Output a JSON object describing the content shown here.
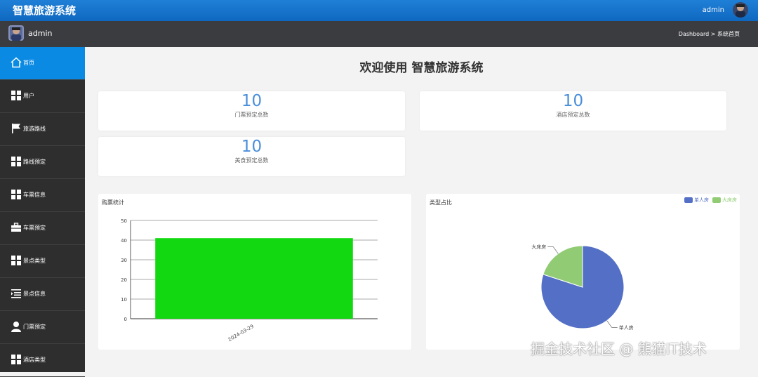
{
  "header": {
    "app_title": "智慧旅游系统",
    "user": "admin"
  },
  "userbar": {
    "user": "admin",
    "breadcrumb": "Dashboard > 系统首页"
  },
  "sidebar": {
    "items": [
      {
        "label": "首页",
        "icon": "home-icon",
        "active": true
      },
      {
        "label": "用户",
        "icon": "grid-icon"
      },
      {
        "label": "旅游路线",
        "icon": "flag-icon"
      },
      {
        "label": "路线预定",
        "icon": "grid-icon"
      },
      {
        "label": "车票信息",
        "icon": "grid-icon"
      },
      {
        "label": "车票预定",
        "icon": "briefcase-icon"
      },
      {
        "label": "景点类型",
        "icon": "grid-icon"
      },
      {
        "label": "景点信息",
        "icon": "list-indent-icon"
      },
      {
        "label": "门票预定",
        "icon": "user-icon"
      },
      {
        "label": "酒店类型",
        "icon": "grid-icon"
      }
    ]
  },
  "main": {
    "welcome": "欢迎使用 智慧旅游系统",
    "stats": [
      {
        "value": "10",
        "label": "门票预定总数"
      },
      {
        "value": "10",
        "label": "酒店预定总数"
      },
      {
        "value": "10",
        "label": "美食预定总数"
      }
    ]
  },
  "chart_data": [
    {
      "type": "bar",
      "title": "购票统计",
      "categories": [
        "2024-03-29"
      ],
      "values": [
        41
      ],
      "ylim": [
        0,
        50
      ],
      "yticks": [
        "0",
        "10",
        "20",
        "30",
        "40",
        "50"
      ],
      "grid": true,
      "color": "#11d811"
    },
    {
      "type": "pie",
      "title": "类型占比",
      "legend_position": "top-right",
      "slices": [
        {
          "name": "单人房",
          "value": 80,
          "color": "#5470c6"
        },
        {
          "name": "大床房",
          "value": 20,
          "color": "#91cc75"
        }
      ]
    }
  ],
  "watermark": "掘金技术社区 @ 熊猫IT技术"
}
